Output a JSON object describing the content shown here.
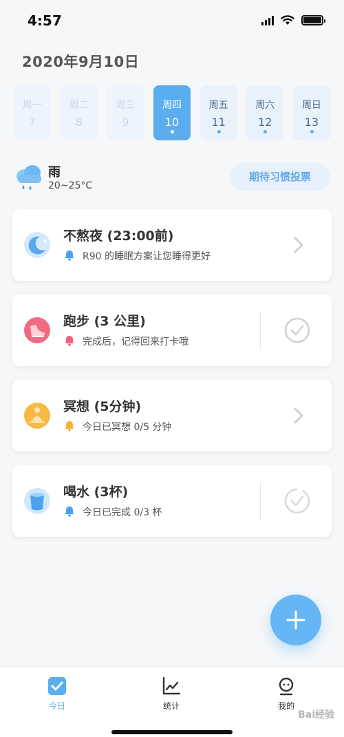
{
  "status_bar": {
    "time": "4:57"
  },
  "header": {
    "date": "2020年9月10日"
  },
  "week": [
    {
      "name": "周一",
      "num": "7",
      "state": "past"
    },
    {
      "name": "周二",
      "num": "8",
      "state": "past"
    },
    {
      "name": "周三",
      "num": "9",
      "state": "past"
    },
    {
      "name": "周四",
      "num": "10",
      "state": "active"
    },
    {
      "name": "周五",
      "num": "11",
      "state": "future"
    },
    {
      "name": "周六",
      "num": "12",
      "state": "future"
    },
    {
      "name": "周日",
      "num": "13",
      "state": "future"
    }
  ],
  "weather": {
    "icon": "rain-cloud-icon",
    "condition": "雨",
    "temp": "20~25°C"
  },
  "vote_button": {
    "label": "期待习惯投票"
  },
  "habits": [
    {
      "title": "不熬夜 (23:00前)",
      "subtitle": "R90 的睡眠方案让您睡得更好",
      "icon": "moon-sleep-icon",
      "bell_color": "#4aa3f0",
      "action": "chevron"
    },
    {
      "title": "跑步 (3 公里)",
      "subtitle": "完成后，记得回来打卡哦",
      "icon": "running-shoe-icon",
      "bell_color": "#f0647a",
      "action": "check"
    },
    {
      "title": "冥想 (5分钟)",
      "subtitle": "今日已冥想 0/5 分钟",
      "icon": "meditation-icon",
      "bell_color": "#f5b23a",
      "action": "chevron"
    },
    {
      "title": "喝水 (3杯)",
      "subtitle": "今日已完成 0/3 杯",
      "icon": "water-cup-icon",
      "bell_color": "#4aa3f0",
      "action": "check"
    }
  ],
  "fab": {
    "icon": "plus-icon"
  },
  "tabbar": {
    "today": "今日",
    "stats": "统计",
    "mine": "我的"
  },
  "watermark": "Bai经验"
}
